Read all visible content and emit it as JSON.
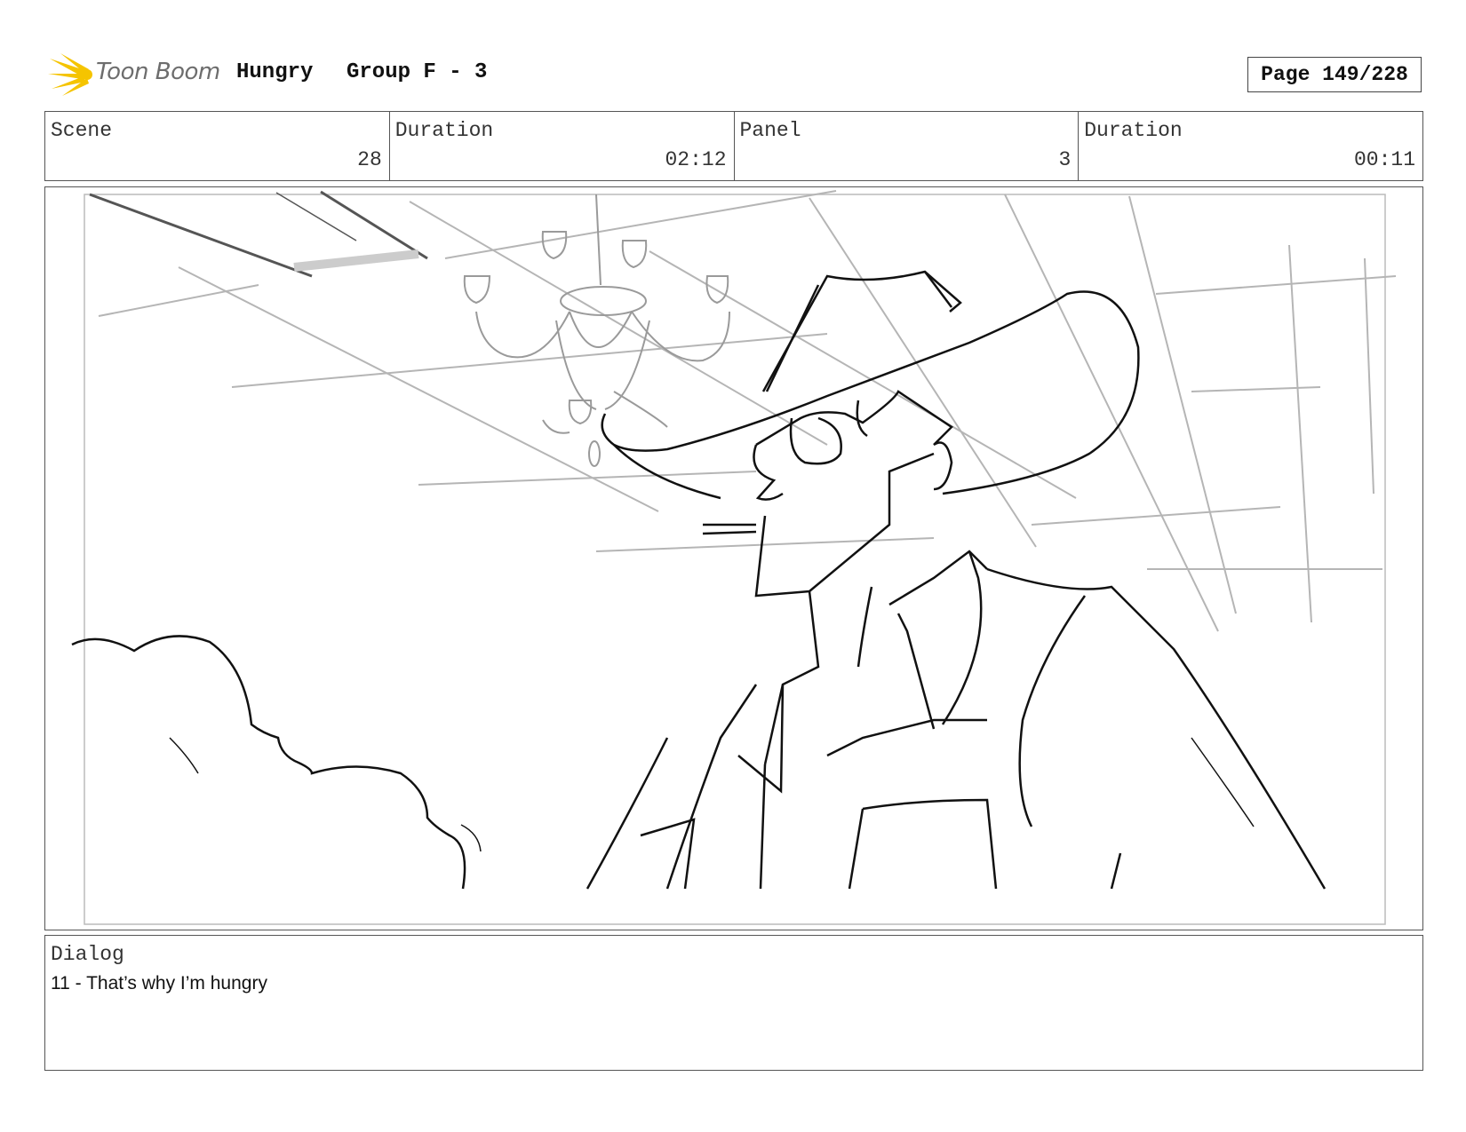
{
  "header": {
    "logo_text": "Toon Boom",
    "project": "Hungry",
    "sequence": "Group F - 3",
    "page": "Page 149/228"
  },
  "info": {
    "scene_label": "Scene",
    "scene_value": "28",
    "scene_duration_label": "Duration",
    "scene_duration_value": "02:12",
    "panel_label": "Panel",
    "panel_value": "3",
    "panel_duration_label": "Duration",
    "panel_duration_value": "00:11"
  },
  "panel": {
    "accent_color": "#f5c400",
    "sketch_color": "#111111",
    "background_color": "#b5b5b5"
  },
  "dialog": {
    "label": "Dialog",
    "text": "11 - That’s why I’m hungry"
  }
}
